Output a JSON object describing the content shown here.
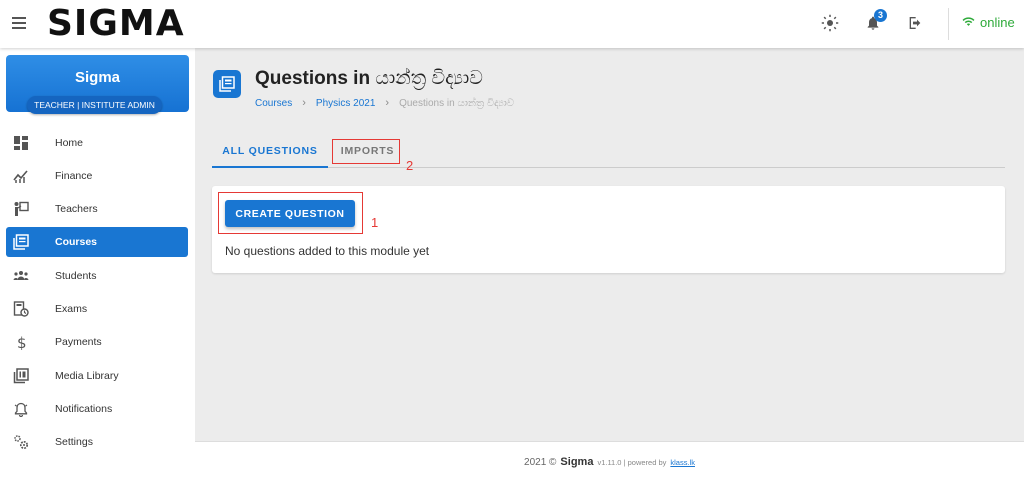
{
  "app": {
    "brand": "SIGMA",
    "notification_count": "3",
    "status": "online"
  },
  "profile": {
    "name": "Sigma",
    "role": "TEACHER | INSTITUTE ADMIN"
  },
  "sidebar": {
    "items": [
      {
        "label": "Home",
        "icon": "dashboard-icon"
      },
      {
        "label": "Finance",
        "icon": "finance-chart-icon"
      },
      {
        "label": "Teachers",
        "icon": "teacher-board-icon"
      },
      {
        "label": "Courses",
        "icon": "courses-icon",
        "active": true
      },
      {
        "label": "Students",
        "icon": "students-group-icon"
      },
      {
        "label": "Exams",
        "icon": "exam-timer-icon"
      },
      {
        "label": "Payments",
        "icon": "dollar-icon"
      },
      {
        "label": "Media Library",
        "icon": "media-library-icon"
      },
      {
        "label": "Notifications",
        "icon": "bell-icon"
      },
      {
        "label": "Settings",
        "icon": "settings-gears-icon"
      }
    ]
  },
  "page": {
    "title_prefix": "Questions in",
    "title_subject": "යාන්ත්‍ර විද්‍යාව",
    "breadcrumb": {
      "courses": "Courses",
      "course": "Physics 2021",
      "current": "Questions in යාන්ත්‍ර විද්‍යාව"
    }
  },
  "tabs": {
    "all": "ALL QUESTIONS",
    "imports": "IMPORTS"
  },
  "annotations": {
    "one": "1",
    "two": "2"
  },
  "card": {
    "create_button": "CREATE QUESTION",
    "empty_message": "No questions added to this module yet"
  },
  "footer": {
    "copyright": "2021 ©",
    "brand": "Sigma",
    "version": "v1.11.0 | powered by",
    "link": "klass.lk"
  },
  "colors": {
    "primary": "#1976d2",
    "online": "#2eaa3a",
    "annotation": "#e53935"
  }
}
